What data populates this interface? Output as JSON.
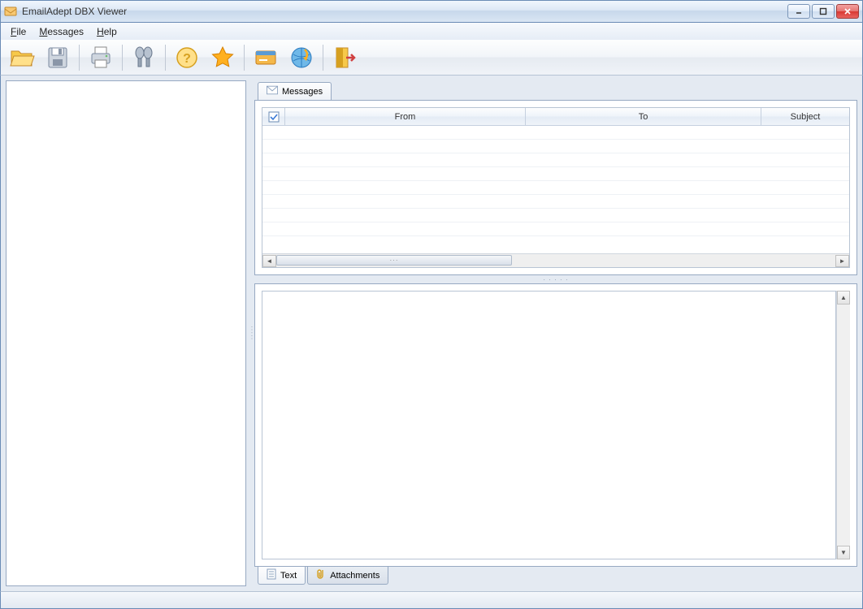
{
  "window": {
    "title": "EmailAdept DBX Viewer"
  },
  "menu": {
    "items": [
      {
        "label": "File",
        "mnemonic": "F"
      },
      {
        "label": "Messages",
        "mnemonic": "M"
      },
      {
        "label": "Help",
        "mnemonic": "H"
      }
    ]
  },
  "toolbar": {
    "buttons": [
      {
        "name": "open-folder",
        "sep_after": false
      },
      {
        "name": "save",
        "sep_after": true
      },
      {
        "name": "print",
        "sep_after": true
      },
      {
        "name": "find",
        "sep_after": true
      },
      {
        "name": "help",
        "sep_after": false
      },
      {
        "name": "favorite",
        "sep_after": true
      },
      {
        "name": "register",
        "sep_after": false
      },
      {
        "name": "home",
        "sep_after": true
      },
      {
        "name": "exit",
        "sep_after": false
      }
    ]
  },
  "messages_tab": {
    "label": "Messages"
  },
  "grid": {
    "columns": [
      {
        "key": "icon",
        "label": ""
      },
      {
        "key": "from",
        "label": "From"
      },
      {
        "key": "to",
        "label": "To"
      },
      {
        "key": "subject",
        "label": "Subject"
      }
    ],
    "rows": []
  },
  "bottom_tabs": {
    "text": "Text",
    "attachments": "Attachments"
  }
}
